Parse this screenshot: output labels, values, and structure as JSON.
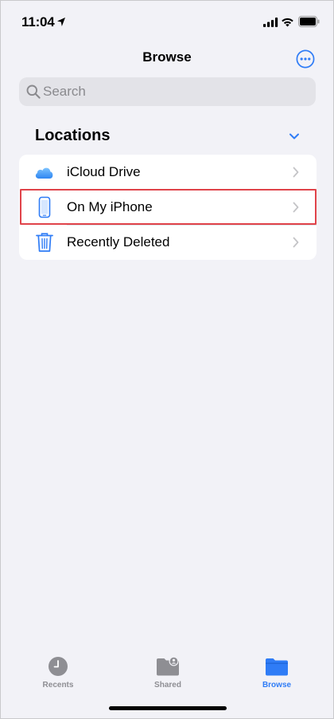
{
  "status_bar": {
    "time": "11:04"
  },
  "nav": {
    "title": "Browse",
    "more_icon": "ellipsis-circle-icon"
  },
  "search": {
    "placeholder": "Search",
    "value": ""
  },
  "locations": {
    "header": "Locations",
    "items": [
      {
        "label": "iCloud Drive",
        "icon": "icloud-icon"
      },
      {
        "label": "On My iPhone",
        "icon": "iphone-icon",
        "highlighted": true
      },
      {
        "label": "Recently Deleted",
        "icon": "trash-icon"
      }
    ]
  },
  "tab_bar": {
    "tabs": [
      {
        "label": "Recents",
        "icon": "clock-icon",
        "active": false
      },
      {
        "label": "Shared",
        "icon": "shared-folder-icon",
        "active": false
      },
      {
        "label": "Browse",
        "icon": "folder-icon",
        "active": true
      }
    ]
  },
  "colors": {
    "accent": "#2f7cf6",
    "inactive": "#8e8e93",
    "highlight": "#e0434a",
    "background": "#f2f2f7"
  }
}
